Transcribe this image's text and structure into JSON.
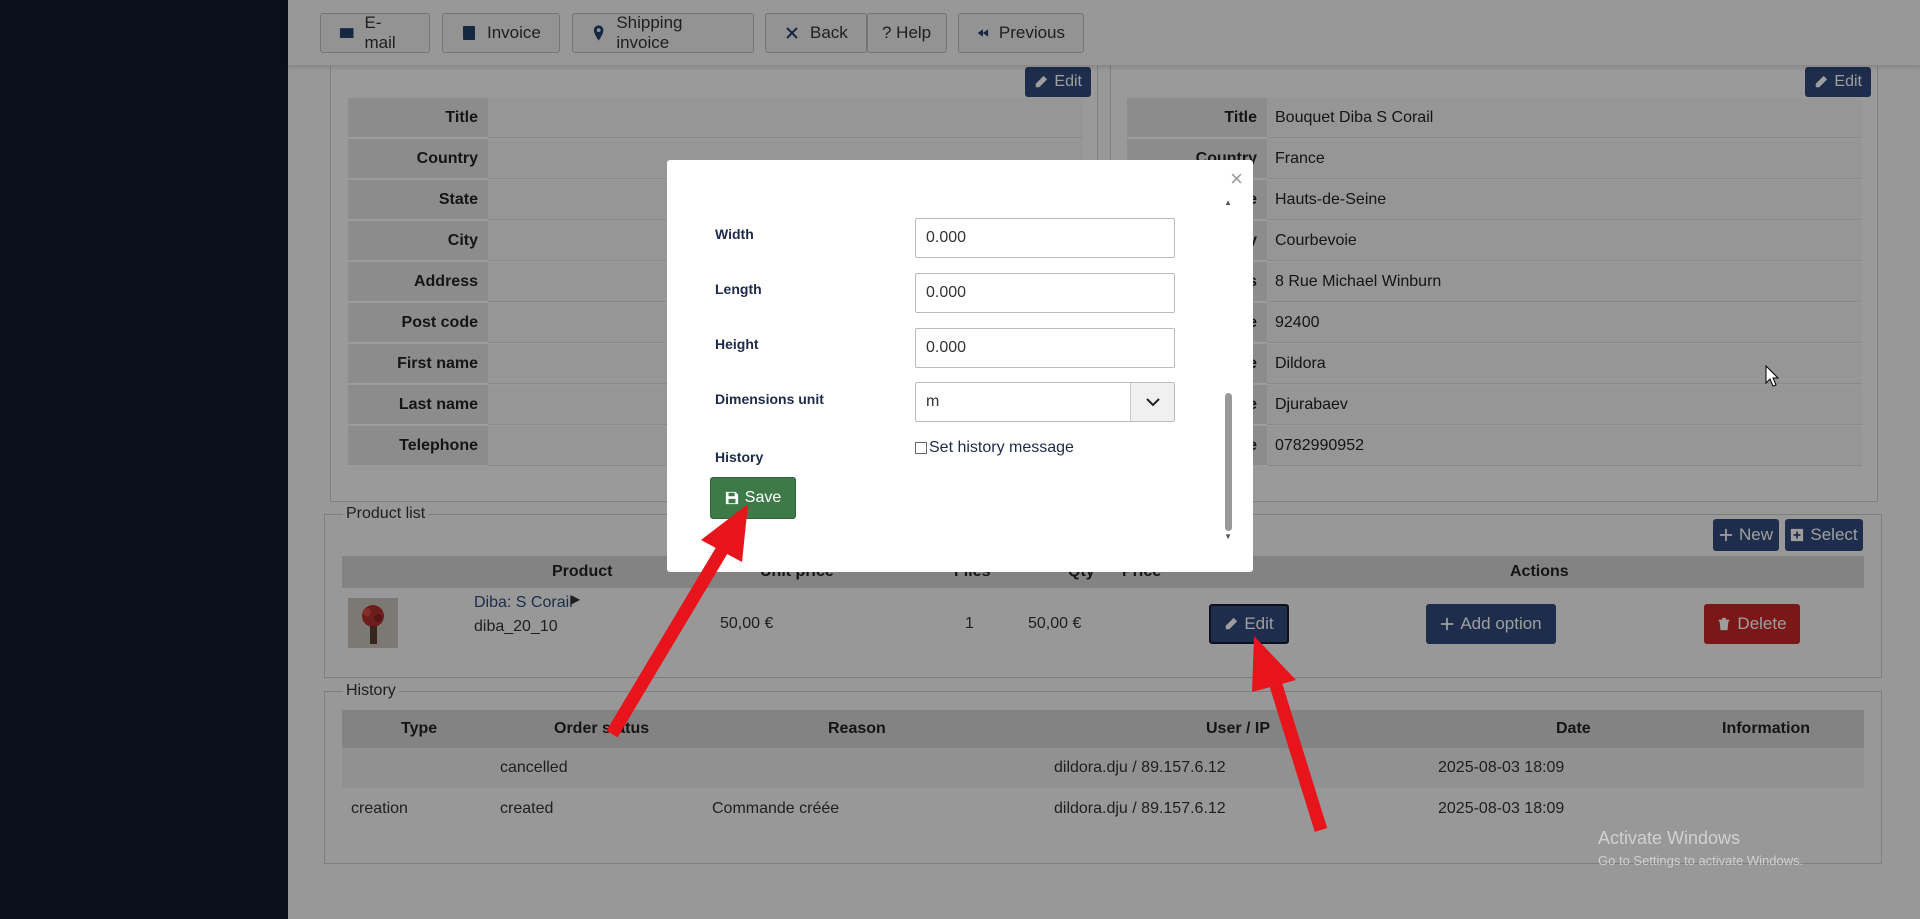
{
  "toolbar": {
    "email": "E-mail",
    "invoice": "Invoice",
    "shipping_invoice": "Shipping invoice",
    "back": "Back",
    "help": "? Help",
    "previous": "Previous"
  },
  "billing": {
    "edit": "Edit",
    "rows": [
      {
        "label": "Title",
        "value": ""
      },
      {
        "label": "Country",
        "value": ""
      },
      {
        "label": "State",
        "value": ""
      },
      {
        "label": "City",
        "value": ""
      },
      {
        "label": "Address",
        "value": ""
      },
      {
        "label": "Post code",
        "value": ""
      },
      {
        "label": "First name",
        "value": ""
      },
      {
        "label": "Last name",
        "value": ""
      },
      {
        "label": "Telephone",
        "value": ""
      }
    ]
  },
  "shipping": {
    "edit": "Edit",
    "rows": [
      {
        "label": "Title",
        "value": "Bouquet Diba S Corail"
      },
      {
        "label": "Country",
        "value": "France"
      },
      {
        "label": "e",
        "value": "Hauts-de-Seine"
      },
      {
        "label": "y",
        "value": "Courbevoie"
      },
      {
        "label": "s",
        "value": "8 Rue Michael Winburn"
      },
      {
        "label": "e",
        "value": "92400"
      },
      {
        "label": "e",
        "value": "Dildora"
      },
      {
        "label": "e",
        "value": "Djurabaev"
      },
      {
        "label": "e",
        "value": "0782990952"
      }
    ]
  },
  "product_list": {
    "legend": "Product list",
    "new": "New",
    "select": "Select",
    "headers": {
      "product": "Product",
      "unit_price": "Unit price",
      "files": "Files",
      "qty": "Qty",
      "price": "Price",
      "actions": "Actions"
    },
    "row": {
      "name": "Diba: S Corail",
      "sku": "diba_20_10",
      "unit_price": "50,00 €",
      "qty": "1",
      "price": "50,00 €",
      "edit": "Edit",
      "add_option": "Add option",
      "delete": "Delete"
    }
  },
  "history": {
    "legend": "History",
    "headers": {
      "type": "Type",
      "order_status": "Order status",
      "reason": "Reason",
      "user_ip": "User / IP",
      "date": "Date",
      "information": "Information"
    },
    "rows": [
      {
        "type": "",
        "status": "cancelled",
        "reason": "",
        "user": "dildora.dju / 89.157.6.12",
        "date": "2025-08-03 18:09",
        "info": ""
      },
      {
        "type": "creation",
        "status": "created",
        "reason": "Commande créée",
        "user": "dildora.dju / 89.157.6.12",
        "date": "2025-08-03 18:09",
        "info": ""
      }
    ]
  },
  "modal": {
    "close": "×",
    "width_label": "Width",
    "width_value": "0.000",
    "length_label": "Length",
    "length_value": "0.000",
    "height_label": "Height",
    "height_value": "0.000",
    "dim_unit_label": "Dimensions unit",
    "dim_unit_value": "m",
    "history_label": "History",
    "history_checkbox": "Set history message",
    "save": "Save"
  },
  "watermark": {
    "line1": "Activate Windows",
    "line2": "Go to Settings to activate Windows."
  },
  "colors": {
    "sidebar": "#101a2b",
    "primary": "#2f4a7a",
    "danger": "#c62828",
    "success": "#3d7a48",
    "annotation_arrow": "#e8141c"
  }
}
